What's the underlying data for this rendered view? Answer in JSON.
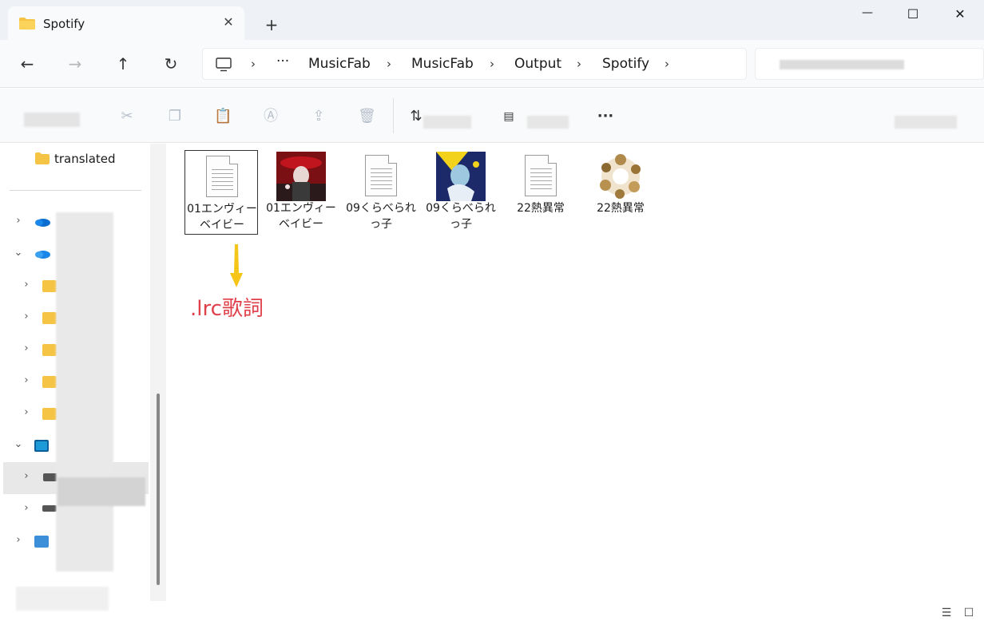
{
  "tab": {
    "title": "Spotify",
    "close": "✕",
    "new_tab": "+"
  },
  "window_controls": {
    "minimize": "—",
    "maximize": "☐",
    "close": "✕"
  },
  "nav": {
    "back": "←",
    "forward": "→",
    "up": "↑",
    "refresh": "↻"
  },
  "breadcrumb": {
    "overflow": "···",
    "items": [
      "MusicFab",
      "MusicFab",
      "Output",
      "Spotify"
    ],
    "separator": "›"
  },
  "toolbar": {
    "more": "···"
  },
  "sidebar": {
    "items": [
      {
        "label": "translated"
      },
      {
        "label": ""
      }
    ]
  },
  "files": [
    {
      "name": "01エンヴィーベイビー",
      "kind": "document"
    },
    {
      "name": "01エンヴィーベイビー",
      "kind": "image"
    },
    {
      "name": "09くらべられっ子",
      "kind": "document"
    },
    {
      "name": "09くらべられっ子",
      "kind": "image"
    },
    {
      "name": "22熱異常",
      "kind": "document"
    },
    {
      "name": "22熱異常",
      "kind": "image"
    }
  ],
  "annotation": {
    "text": ".lrc歌詞",
    "color": "#e0404a"
  },
  "colors": {
    "accent_arrow": "#f5c518",
    "folder": "#f6c445",
    "onedrive": "#0a6ed1"
  }
}
